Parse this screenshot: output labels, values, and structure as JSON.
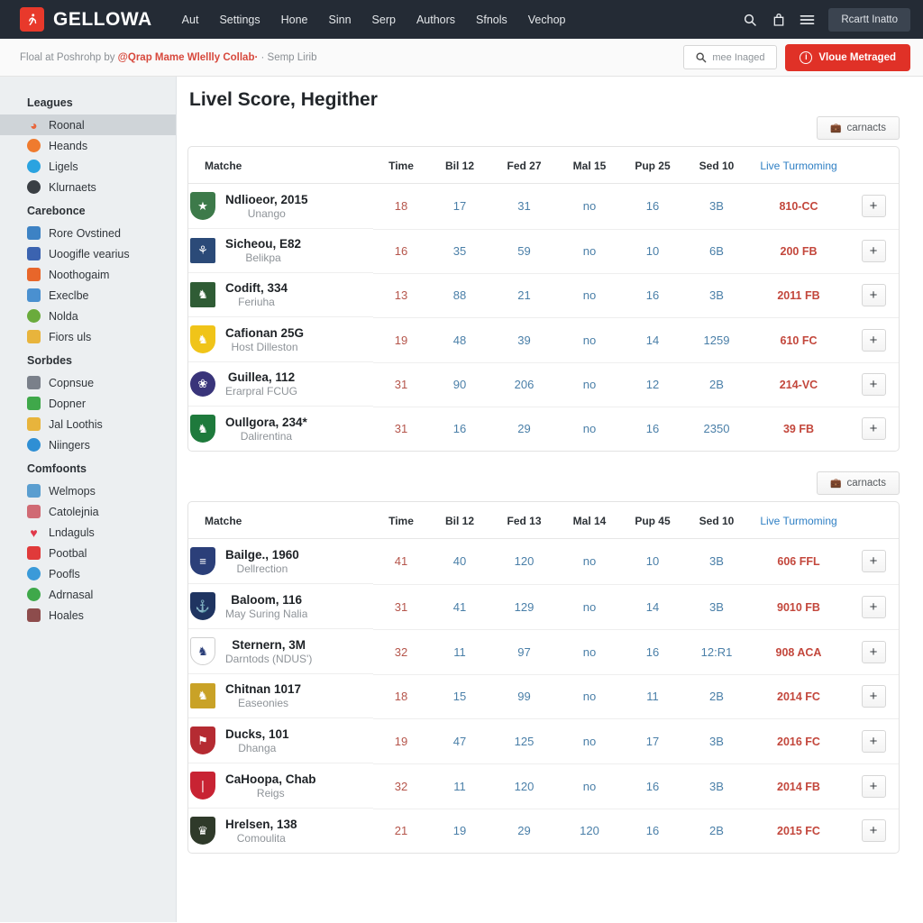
{
  "topnav": {
    "brand": "GELLOWA",
    "brand_icon": "runner-logo-icon",
    "links": [
      "Aut",
      "Settings",
      "Hone",
      "Sinn",
      "Serp",
      "Authors",
      "Sfnols",
      "Vechop"
    ],
    "search_icon": "search-icon",
    "bag_icon": "bag-icon",
    "menu_icon": "hamburger-menu-icon",
    "cta_label": "Rcartt Inatto"
  },
  "subheader": {
    "prefix": "Floal at Poshrohp by ",
    "highlight": "@Qrap Mame Wlellly Collab·",
    "suffix": " · Semp Lirib",
    "search_placeholder": "mee Inaged",
    "search_icon": "search-icon",
    "cta_label": "Vloue Metraged",
    "cta_icon": "info-circle-icon",
    "cta_color": "#e03127"
  },
  "sidebar": {
    "groups": [
      {
        "title": "Leagues",
        "items": [
          {
            "label": "Roonal",
            "icon": "flame-icon",
            "color": "#e8663c",
            "active": true
          },
          {
            "label": "Heands",
            "icon": "moon-icon",
            "color": "#ef7b2e",
            "active": false
          },
          {
            "label": "Ligels",
            "icon": "globe-icon",
            "color": "#2aa3e0",
            "active": false
          },
          {
            "label": "Klurnaets",
            "icon": "football-icon",
            "color": "#3a3f44",
            "active": false
          }
        ]
      },
      {
        "title": "Carebonce",
        "items": [
          {
            "label": "Rore Ovstined",
            "icon": "anchor-icon",
            "color": "#3d82c4",
            "active": false
          },
          {
            "label": "Uoogifle vearius",
            "icon": "person-icon",
            "color": "#3b63b0",
            "active": false
          },
          {
            "label": "Noothogaim",
            "icon": "mail-icon",
            "color": "#e8662a",
            "active": false
          },
          {
            "label": "Execlbe",
            "icon": "image-icon",
            "color": "#4a90d0",
            "active": false
          },
          {
            "label": "Nolda",
            "icon": "clock-icon",
            "color": "#6aab3c",
            "active": false
          },
          {
            "label": "Fiors uls",
            "icon": "card-icon",
            "color": "#e8b43c",
            "active": false
          }
        ]
      },
      {
        "title": "Sorbdes",
        "items": [
          {
            "label": "Copnsue",
            "icon": "trophy-icon",
            "color": "#7a808a",
            "active": false
          },
          {
            "label": "Dopner",
            "icon": "leaf-icon",
            "color": "#3fa84a",
            "active": false
          },
          {
            "label": "Jal Loothis",
            "icon": "folder-icon",
            "color": "#e8b43c",
            "active": false
          },
          {
            "label": "Niingers",
            "icon": "circle-icon",
            "color": "#2f8fd4",
            "active": false
          }
        ]
      },
      {
        "title": "Comfoonts",
        "items": [
          {
            "label": "Welmops",
            "icon": "user-icon",
            "color": "#5a9ed0",
            "active": false
          },
          {
            "label": "Catolejnia",
            "icon": "paw-icon",
            "color": "#d06a74",
            "active": false
          },
          {
            "label": "Lndaguls",
            "icon": "heart-icon",
            "color": "#e0384a",
            "active": false
          },
          {
            "label": "Pootbal",
            "icon": "pin-icon",
            "color": "#e03a3a",
            "active": false
          },
          {
            "label": "Poofls",
            "icon": "contrast-icon",
            "color": "#3a9ad9",
            "active": false
          },
          {
            "label": "Adrnasal",
            "icon": "target-icon",
            "color": "#3fa84a",
            "active": false
          },
          {
            "label": "Hoales",
            "icon": "flag-icon",
            "color": "#8d4c4c",
            "active": false
          }
        ]
      }
    ]
  },
  "main": {
    "page_title": "Livel Score, Hegither",
    "contacts_label": "carnacts",
    "contacts_icon": "briefcase-icon",
    "add_row_label": "+"
  },
  "chart_data": {
    "type": "table",
    "title": "Livel Score, Hegither",
    "tables": [
      {
        "columns": [
          "Matche",
          "Time",
          "Bil 12",
          "Fed 27",
          "Mal 15",
          "Pup 25",
          "Sed 10",
          "Live Turmoming",
          ""
        ],
        "rows": [
          {
            "title": "Ndlioeor, 2015",
            "sub": "Unango",
            "crest": {
              "shape": "shield",
              "color": "#3d7a4a",
              "glyph": "★"
            },
            "time": "18",
            "bil": "17",
            "fed": "31",
            "mal": "no",
            "pup": "16",
            "sed": "3B",
            "live": "810-CC"
          },
          {
            "title": "Sicheou, E82",
            "sub": "Belikpa",
            "crest": {
              "shape": "square",
              "color": "#2b4a78",
              "glyph": "⚘"
            },
            "time": "16",
            "bil": "35",
            "fed": "59",
            "mal": "no",
            "pup": "10",
            "sed": "6B",
            "live": "200 FB"
          },
          {
            "title": "Codift, 334",
            "sub": "Feriuha",
            "crest": {
              "shape": "square",
              "color": "#2f5c35",
              "glyph": "♞"
            },
            "time": "13",
            "bil": "88",
            "fed": "21",
            "mal": "no",
            "pup": "16",
            "sed": "3B",
            "live": "2011 FB"
          },
          {
            "title": "Cafionan 25G",
            "sub": "Host Dilleston",
            "crest": {
              "shape": "shield",
              "color": "#f0c419",
              "glyph": "♞"
            },
            "time": "19",
            "bil": "48",
            "fed": "39",
            "mal": "no",
            "pup": "14",
            "sed": "1259",
            "live": "610 FC"
          },
          {
            "title": "Guillea, 112",
            "sub": "Erarpral FCUG",
            "crest": {
              "shape": "round",
              "color": "#39347a",
              "glyph": "❀"
            },
            "time": "31",
            "bil": "90",
            "fed": "206",
            "mal": "no",
            "pup": "12",
            "sed": "2B",
            "live": "214-VC"
          },
          {
            "title": "Oullgora, 234*",
            "sub": "Dalirentina",
            "crest": {
              "shape": "shield",
              "color": "#1e7a3c",
              "glyph": "♞"
            },
            "time": "31",
            "bil": "16",
            "fed": "29",
            "mal": "no",
            "pup": "16",
            "sed": "2350",
            "live": "39 FB"
          }
        ]
      },
      {
        "columns": [
          "Matche",
          "Time",
          "Bil 12",
          "Fed 13",
          "Mal 14",
          "Pup 45",
          "Sed 10",
          "Live Turmoming",
          ""
        ],
        "rows": [
          {
            "title": "Bailge., 1960",
            "sub": "Dellrection",
            "crest": {
              "shape": "shield",
              "color": "#2b3f79",
              "glyph": "≡"
            },
            "time": "41",
            "bil": "40",
            "fed": "120",
            "mal": "no",
            "pup": "10",
            "sed": "3B",
            "live": "606 FFL"
          },
          {
            "title": "Baloom, 116",
            "sub": "May Suring Nalia",
            "crest": {
              "shape": "shield",
              "color": "#1f3461",
              "glyph": "⚓"
            },
            "time": "31",
            "bil": "41",
            "fed": "129",
            "mal": "no",
            "pup": "14",
            "sed": "3B",
            "live": "9010 FB"
          },
          {
            "title": "Sternern, 3M",
            "sub": "Darntods (NDUS')",
            "crest": {
              "shape": "shield",
              "color": "#ffffff",
              "glyph": "♞"
            },
            "time": "32",
            "bil": "11",
            "fed": "97",
            "mal": "no",
            "pup": "16",
            "sed": "12:R1",
            "live": "908 ACA"
          },
          {
            "title": "Chitnan 1017",
            "sub": "Easeonies",
            "crest": {
              "shape": "square",
              "color": "#c9a227",
              "glyph": "♞"
            },
            "time": "18",
            "bil": "15",
            "fed": "99",
            "mal": "no",
            "pup": "11",
            "sed": "2B",
            "live": "2014 FC"
          },
          {
            "title": "Ducks, 101",
            "sub": "Dhanga",
            "crest": {
              "shape": "shield",
              "color": "#b52b32",
              "glyph": "⚑"
            },
            "time": "19",
            "bil": "47",
            "fed": "125",
            "mal": "no",
            "pup": "17",
            "sed": "3B",
            "live": "2016 FC"
          },
          {
            "title": "CaHoopa, Chab",
            "sub": "Reigs",
            "crest": {
              "shape": "shield",
              "color": "#c82333",
              "glyph": "❘"
            },
            "time": "32",
            "bil": "11",
            "fed": "120",
            "mal": "no",
            "pup": "16",
            "sed": "3B",
            "live": "2014 FB"
          },
          {
            "title": "Hrelsen, 138",
            "sub": "Comoulita",
            "crest": {
              "shape": "shield",
              "color": "#2f3a2a",
              "glyph": "♛"
            },
            "time": "21",
            "bil": "19",
            "fed": "29",
            "mal": "120",
            "pup": "16",
            "sed": "2B",
            "live": "2015 FC"
          }
        ]
      }
    ]
  }
}
